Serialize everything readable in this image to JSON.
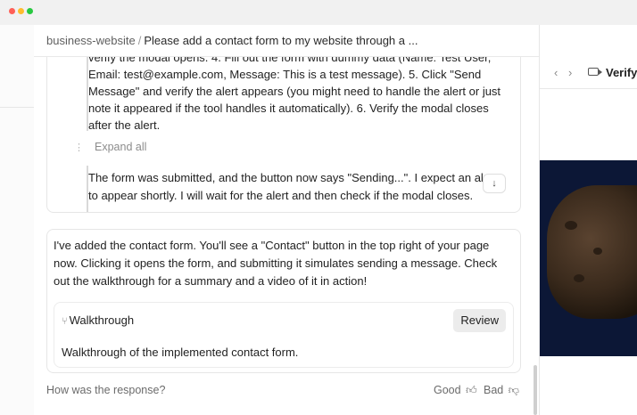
{
  "breadcrumb": {
    "project": "business-website",
    "separator": "/",
    "task": "Please add a contact form to my website through a ..."
  },
  "steps_text": "verify the modal opens. 4. Fill out the form with dummy data (Name: Test User, Email: test@example.com, Message: This is a test message). 5. Click \"Send Message\" and verify the alert appears (you might need to handle the alert or just note it appeared if the tool handles it automatically). 6. Verify the modal closes after the alert.",
  "expand_all": "Expand all",
  "thought_text": "The form was submitted, and the button now says \"Sending...\". I expect an alert to appear shortly. I will wait for the alert and then check if the modal closes.",
  "reply_text": "I've added the contact form. You'll see a \"Contact\" button in the top right of your page now. Clicking it opens the form, and submitting it simulates sending a message. Check out the walkthrough for a summary and a video of it in action!",
  "walkthrough": {
    "title": "Walkthrough",
    "review_label": "Review",
    "description": "Walkthrough of the implemented contact form."
  },
  "feedback": {
    "question": "How was the response?",
    "good_label": "Good",
    "bad_label": "Bad"
  },
  "right_pane": {
    "title": "Verify",
    "back_icon": "chevron-left-icon",
    "forward_icon": "chevron-right-icon",
    "video_icon": "video-camera-icon"
  },
  "icons": {
    "scroll_down": "arrow-down-icon",
    "walkthrough": "branch-icon",
    "thumbs_up": "thumbs-up-icon",
    "thumbs_down": "thumbs-down-icon"
  },
  "colors": {
    "titlebar": "#f1f1f1",
    "close": "#ff5f57",
    "minimize": "#febc2e",
    "maximize": "#28c840",
    "video_bg": "#0c1736",
    "review_bg": "#ececec"
  }
}
